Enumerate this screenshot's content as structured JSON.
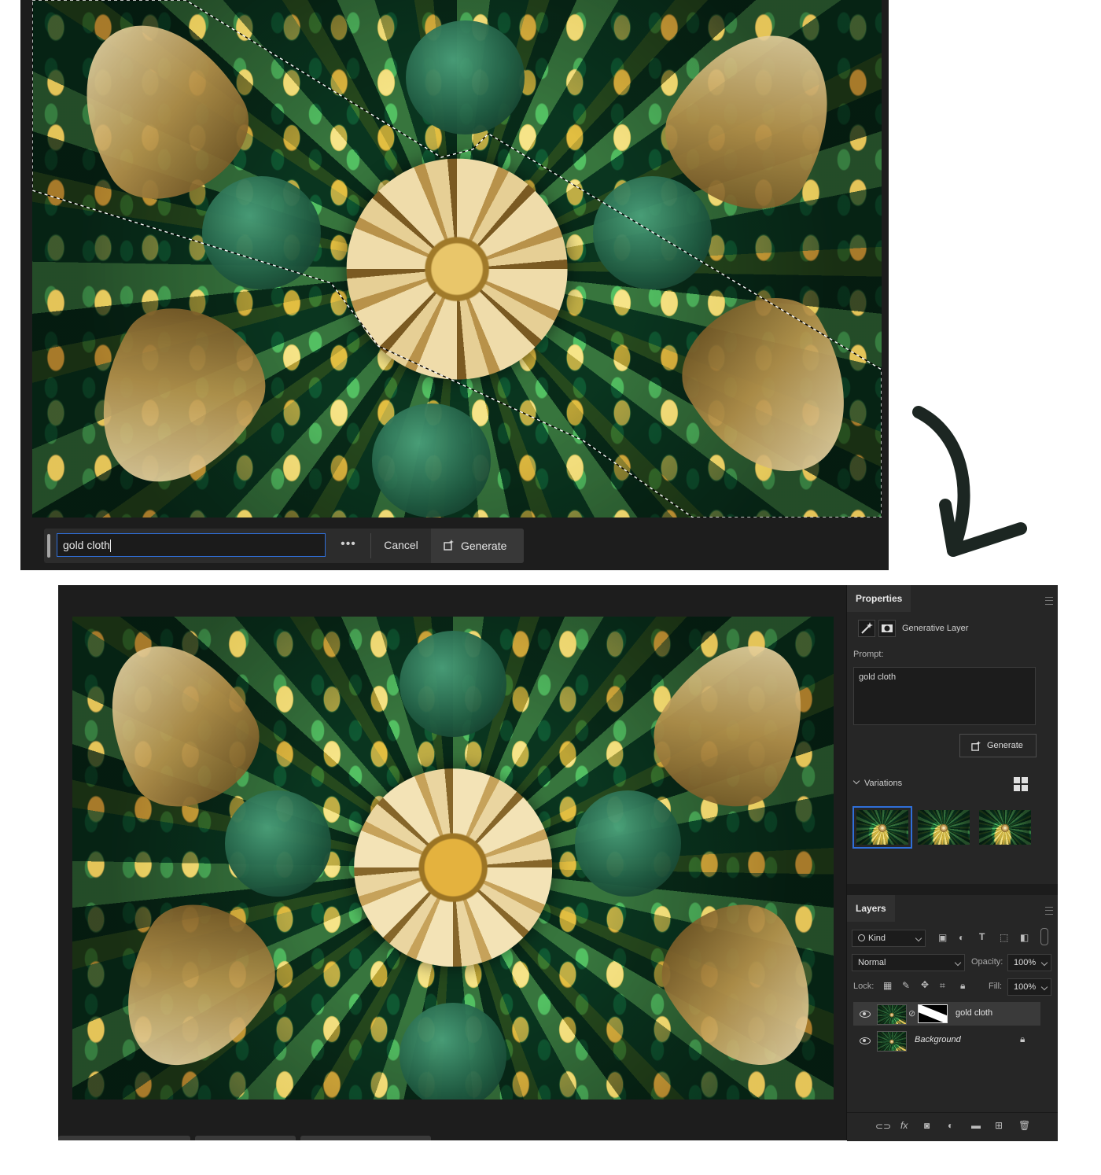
{
  "task_bar": {
    "prompt_value": "gold cloth",
    "more_label": "•••",
    "cancel_label": "Cancel",
    "generate_label": "Generate"
  },
  "properties": {
    "tab_label": "Properties",
    "layer_type": "Generative Layer",
    "prompt_label": "Prompt:",
    "prompt_value": "gold cloth",
    "generate_label": "Generate",
    "variations_label": "Variations",
    "variations_count": 3,
    "selected_variation": 1
  },
  "layers": {
    "tab_label": "Layers",
    "filter_label": "Kind",
    "blend_mode": "Normal",
    "opacity_label": "Opacity:",
    "opacity_value": "100%",
    "lock_label": "Lock:",
    "fill_label": "Fill:",
    "fill_value": "100%",
    "items": [
      {
        "name": "gold cloth",
        "visible": true,
        "selected": true
      },
      {
        "name": "Background",
        "visible": true,
        "locked": true
      }
    ]
  },
  "icons": {
    "more": "ellipsis-icon",
    "generate": "generate-icon",
    "arrow": "curved-arrow-icon"
  },
  "colors": {
    "accent": "#2f6fd9",
    "panel_bg": "#262626",
    "canvas_bg": "#1d1d1d"
  }
}
